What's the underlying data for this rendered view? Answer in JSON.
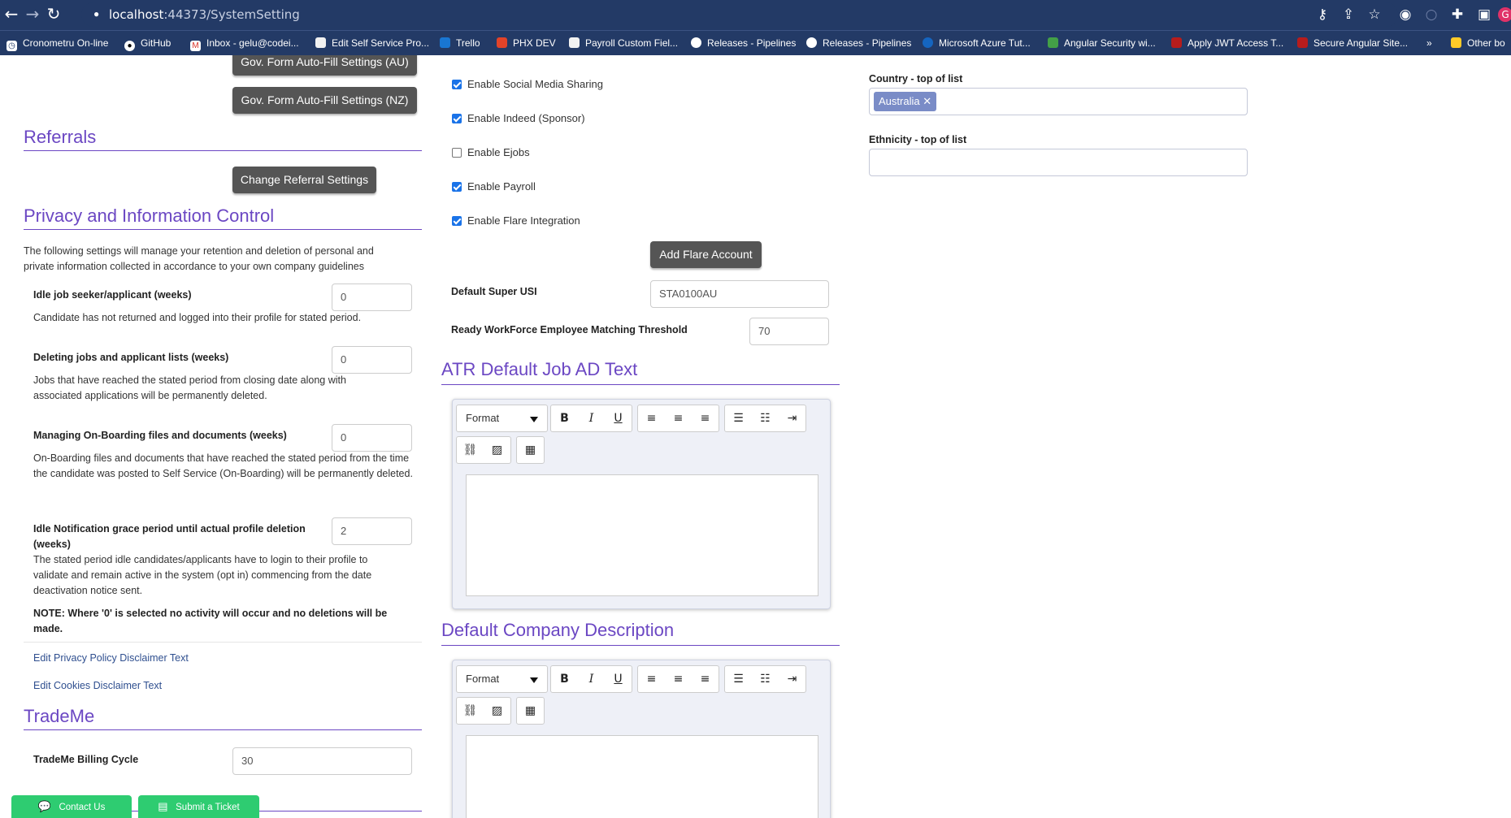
{
  "browser": {
    "url_host": "localhost",
    "url_rest": ":44373/SystemSetting",
    "bookmarks": [
      "Cronometru On-line",
      "GitHub",
      "Inbox - gelu@codei...",
      "Edit Self Service Pro...",
      "Trello",
      "PHX DEV",
      "Payroll Custom Fiel...",
      "Releases - Pipelines",
      "Releases - Pipelines",
      "Microsoft Azure Tut...",
      "Angular Security wi...",
      "Apply JWT Access T...",
      "Secure Angular Site...",
      "»",
      "Other bo"
    ]
  },
  "left": {
    "gov_au_button": "Gov. Form Auto-Fill Settings (AU)",
    "gov_nz_button": "Gov. Form Auto-Fill Settings (NZ)",
    "referrals_title": "Referrals",
    "referral_button": "Change Referral Settings",
    "privacy_title": "Privacy and Information Control",
    "privacy_intro": "The following settings will manage your retention and deletion of personal and private information collected in accordance to your own company guidelines",
    "settings": [
      {
        "label": "Idle job seeker/applicant (weeks)",
        "desc": "Candidate has not returned and logged into their profile for stated period.",
        "value": "0"
      },
      {
        "label": "Deleting jobs and applicant lists (weeks)",
        "desc": "Jobs that have reached the stated period from closing date along with associated applications will be permanently deleted.",
        "value": "0"
      },
      {
        "label": "Managing On-Boarding files and documents (weeks)",
        "desc": "On-Boarding files and documents that have reached the stated period from the time the candidate was posted to Self Service (On-Boarding) will be permanently deleted.",
        "value": "0"
      },
      {
        "label": "Idle Notification grace period until actual profile deletion (weeks)",
        "desc": "The stated period idle candidates/applicants have to login to their profile to validate and remain active in the system (opt in) commencing from the date deactivation notice sent.",
        "value": "2"
      }
    ],
    "note": "NOTE: Where '0' is selected no activity will occur and no deletions will be made.",
    "privacy_link": "Edit Privacy Policy Disclaimer Text",
    "cookies_link": "Edit Cookies Disclaimer Text",
    "trademe_title": "TradeMe",
    "billing_label": "TradeMe Billing Cycle",
    "billing_value": "30",
    "contact_button": "Contact Us",
    "ticket_button": "Submit a Ticket"
  },
  "middle": {
    "checks": [
      {
        "label": "Enable Social Media Sharing",
        "checked": true
      },
      {
        "label": "Enable Indeed (Sponsor)",
        "checked": true
      },
      {
        "label": "Enable Ejobs",
        "checked": false
      },
      {
        "label": "Enable Payroll",
        "checked": true
      },
      {
        "label": "Enable Flare Integration",
        "checked": true
      }
    ],
    "flare_button": "Add Flare Account",
    "super_usi_label": "Default Super USI",
    "super_usi_value": "STA0100AU",
    "threshold_label": "Ready WorkForce Employee Matching Threshold",
    "threshold_value": "70",
    "atr_title": "ATR Default Job AD Text",
    "company_title": "Default Company Description",
    "format_label": "Format"
  },
  "right": {
    "country_label": "Country - top of list",
    "country_tag": "Australia",
    "ethnicity_label": "Ethnicity - top of list"
  }
}
